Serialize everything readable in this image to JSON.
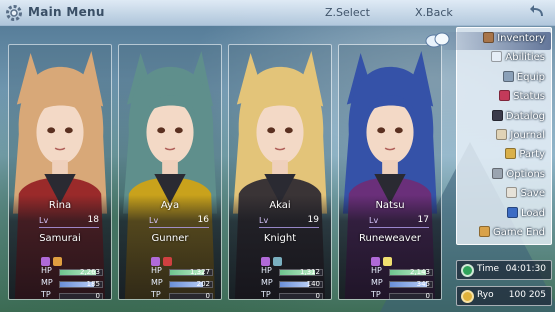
{
  "window": {
    "title": "Main Menu",
    "hint_select": "Z.Select",
    "hint_back": "X.Back"
  },
  "party": [
    {
      "name": "Rina",
      "level_label": "Lv",
      "level": "18",
      "class": "Samurai",
      "hp_label": "HP",
      "hp": "2,263",
      "hp_fill": 0.86,
      "mp_label": "MP",
      "mp": "185",
      "mp_fill": 0.8,
      "tp_label": "TP",
      "tp": "0",
      "tp_fill": 0.0,
      "hair": "#d8a878",
      "outfit": "#9a2a2a"
    },
    {
      "name": "Aya",
      "level_label": "Lv",
      "level": "16",
      "class": "Gunner",
      "hp_label": "HP",
      "hp": "1,327",
      "hp_fill": 0.82,
      "mp_label": "MP",
      "mp": "202",
      "mp_fill": 0.78,
      "tp_label": "TP",
      "tp": "0",
      "tp_fill": 0.0,
      "hair": "#5f8f8c",
      "outfit": "#c9a21c"
    },
    {
      "name": "Akai",
      "level_label": "Lv",
      "level": "19",
      "class": "Knight",
      "hp_label": "HP",
      "hp": "1,312",
      "hp_fill": 0.84,
      "mp_label": "MP",
      "mp": "140",
      "mp_fill": 0.7,
      "tp_label": "TP",
      "tp": "0",
      "tp_fill": 0.0,
      "hair": "#e3c479",
      "outfit": "#3a3436"
    },
    {
      "name": "Natsu",
      "level_label": "Lv",
      "level": "17",
      "class": "Runeweaver",
      "hp_label": "HP",
      "hp": "2,143",
      "hp_fill": 0.86,
      "mp_label": "MP",
      "mp": "345",
      "mp_fill": 0.88,
      "tp_label": "TP",
      "tp": "0",
      "tp_fill": 0.0,
      "hair": "#3552a8",
      "outfit": "#6a2f7a"
    }
  ],
  "menu": {
    "items": [
      {
        "label": "Inventory",
        "icon": "bag-icon",
        "color": "#a8754a",
        "selected": true
      },
      {
        "label": "Abilities",
        "icon": "wings-icon",
        "color": "#e6eef7",
        "selected": false
      },
      {
        "label": "Equip",
        "icon": "sword-icon",
        "color": "#8aa0b8",
        "selected": false
      },
      {
        "label": "Status",
        "icon": "book-icon",
        "color": "#c43a5a",
        "selected": false
      },
      {
        "label": "Datalog",
        "icon": "log-icon",
        "color": "#3a3a4a",
        "selected": false
      },
      {
        "label": "Journal",
        "icon": "quill-icon",
        "color": "#e0d3b6",
        "selected": false
      },
      {
        "label": "Party",
        "icon": "party-icon",
        "color": "#d9b04a",
        "selected": false
      },
      {
        "label": "Options",
        "icon": "wrench-icon",
        "color": "#9aa4b0",
        "selected": false
      },
      {
        "label": "Save",
        "icon": "save-quill-icon",
        "color": "#e6e2d8",
        "selected": false
      },
      {
        "label": "Load",
        "icon": "disk-icon",
        "color": "#3c6cc4",
        "selected": false
      },
      {
        "label": "Game End",
        "icon": "scroll-icon",
        "color": "#d9a24a",
        "selected": false
      }
    ]
  },
  "time": {
    "label": "Time",
    "value": "04:01:30",
    "icon": "clock-icon",
    "color": "#2fa35a"
  },
  "gold": {
    "label": "Ryo",
    "value": "100 205",
    "icon": "coin-icon",
    "color": "#e0b23a"
  }
}
